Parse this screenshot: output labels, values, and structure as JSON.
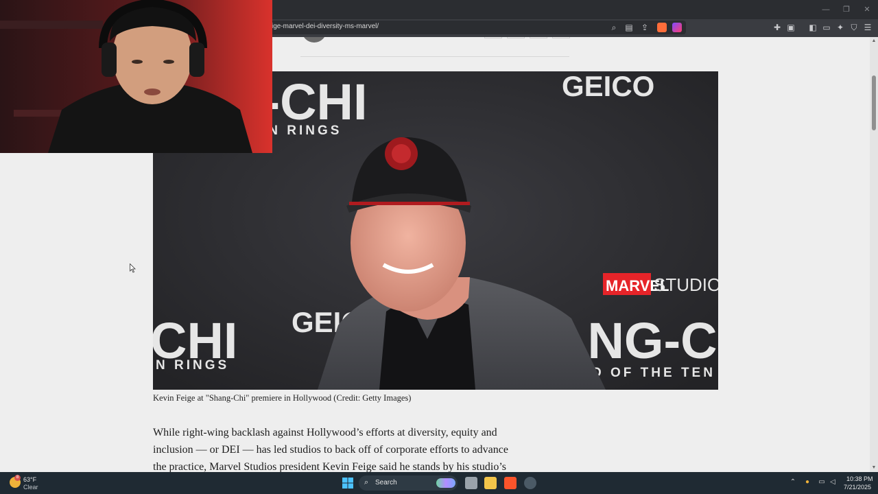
{
  "browser": {
    "url": "ige-marvel-dei-diversity-ms-marvel/"
  },
  "article": {
    "hero_logos": {
      "left_title": "ANG-CHI",
      "left_sub": "D OF THE TEN RINGS",
      "sponsor_top": "GEICO",
      "studio_marvel": "MARVEL",
      "studio_word": "STUDIOS",
      "left_lower": "CHI",
      "left_lower_sub": "N RINGS",
      "sponsor_lower": "GEIC",
      "right_lower": "ANG-C",
      "right_lower_sub": "D OF THE TEN"
    },
    "caption": "Kevin Feige at \"Shang-Chi\" premiere in Hollywood (Credit: Getty Images)",
    "paragraph": "While right-wing backlash against Hollywood’s efforts at diversity, equity and inclusion — or DEI — has led studios to back off of corporate efforts to advance the practice, Marvel Studios president Kevin Feige said he stands by his studio’s"
  },
  "taskbar": {
    "temperature": "63°F",
    "weather": "Clear",
    "weather_badge": "8",
    "search_label": "Search",
    "time": "10:38 PM",
    "date": "7/21/2025"
  },
  "colors": {
    "marvel_red": "#e62429",
    "page_bg": "#eeeeee",
    "chrome_dark": "#2b2d31"
  }
}
